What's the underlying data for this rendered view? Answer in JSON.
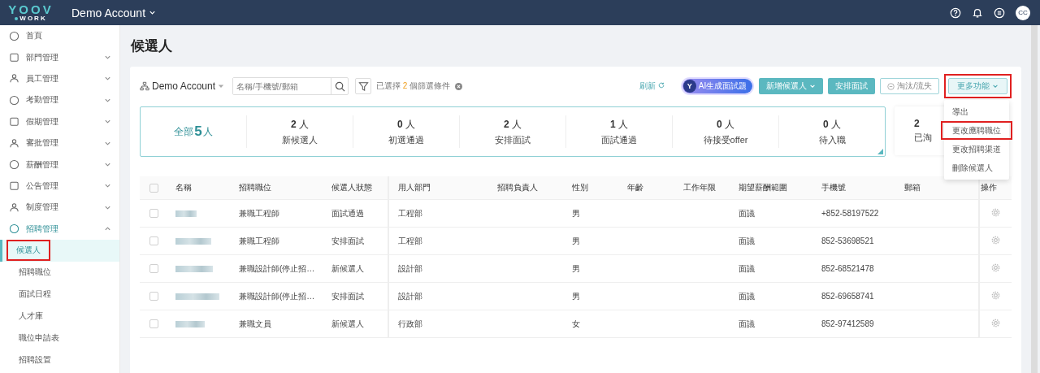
{
  "topbar": {
    "logo_top": "YOOV",
    "logo_bottom": "WORK",
    "account": "Demo Account",
    "avatar": "CC"
  },
  "sidebar": {
    "items": [
      {
        "label": "首頁"
      },
      {
        "label": "部門管理",
        "expanded": false
      },
      {
        "label": "員工管理",
        "expanded": false
      },
      {
        "label": "考勤管理",
        "expanded": false
      },
      {
        "label": "假期管理",
        "expanded": false
      },
      {
        "label": "審批管理",
        "expanded": false
      },
      {
        "label": "薪酬管理",
        "expanded": false
      },
      {
        "label": "公告管理",
        "expanded": false
      },
      {
        "label": "制度管理",
        "expanded": false
      },
      {
        "label": "招聘管理",
        "expanded": true,
        "children": [
          {
            "label": "候選人",
            "selected": true,
            "highlighted": true
          },
          {
            "label": "招聘職位",
            "selected": false,
            "highlighted": false
          },
          {
            "label": "面試日程",
            "selected": false,
            "highlighted": false
          },
          {
            "label": "人才庫",
            "selected": false,
            "highlighted": false
          },
          {
            "label": "職位申請表",
            "selected": false,
            "highlighted": false
          },
          {
            "label": "招聘設置",
            "selected": false,
            "highlighted": false
          }
        ]
      }
    ]
  },
  "page_title": "候選人",
  "toolbar": {
    "account": "Demo Account",
    "search_placeholder": "名稱/手機號/郵箱",
    "filter_prefix": "已選擇",
    "filter_count": "2",
    "filter_suffix": "個篩選條件",
    "refresh": "刷新",
    "ai_button": "AI生成面試題",
    "ai_logo": "Y",
    "add_button": "新增候選人",
    "schedule_button": "安排面試",
    "reject_button": "淘汰/流失",
    "more_button": "更多功能",
    "more_highlighted": true
  },
  "more_menu": [
    {
      "label": "導出",
      "highlighted": false
    },
    {
      "label": "更改應聘職位",
      "highlighted": true
    },
    {
      "label": "更改招聘渠道",
      "highlighted": false
    },
    {
      "label": "刪除候選人",
      "highlighted": false
    }
  ],
  "summary": {
    "total_label": "全部",
    "total_count": "5",
    "total_unit": "人",
    "stats": [
      {
        "count": "2",
        "unit": "人",
        "label": "新候選人"
      },
      {
        "count": "0",
        "unit": "人",
        "label": "初選通過"
      },
      {
        "count": "2",
        "unit": "人",
        "label": "安排面試"
      },
      {
        "count": "1",
        "unit": "人",
        "label": "面試通過"
      },
      {
        "count": "0",
        "unit": "人",
        "label": "待接受offer"
      },
      {
        "count": "0",
        "unit": "人",
        "label": "待入職"
      }
    ],
    "side_card": {
      "count": "2",
      "label": "已淘"
    }
  },
  "table": {
    "all_checked": false,
    "columns": [
      "名稱",
      "招聘職位",
      "候選人狀態",
      "用人部門",
      "招聘負責人",
      "性別",
      "年齡",
      "工作年限",
      "期望薪酬範圍",
      "手機號",
      "郵箱",
      "操作"
    ],
    "rows": [
      {
        "checked": false,
        "name_redacted": true,
        "position": "兼職工程師",
        "status": "面試通過",
        "department": "工程部",
        "gender": "男",
        "salary": "面議",
        "phone": "+852-58197522"
      },
      {
        "checked": false,
        "name_redacted": true,
        "position": "兼職工程師",
        "status": "安排面試",
        "department": "工程部",
        "gender": "男",
        "salary": "面議",
        "phone": "852-53698521"
      },
      {
        "checked": false,
        "name_redacted": true,
        "position": "兼職設計師(停止招…",
        "status": "新候選人",
        "department": "設計部",
        "gender": "男",
        "salary": "面議",
        "phone": "852-68521478"
      },
      {
        "checked": false,
        "name_redacted": true,
        "position": "兼職設計師(停止招…",
        "status": "安排面試",
        "department": "設計部",
        "gender": "男",
        "salary": "面議",
        "phone": "852-69658741"
      },
      {
        "checked": false,
        "name_redacted": true,
        "position": "兼職文員",
        "status": "新候選人",
        "department": "行政部",
        "gender": "女",
        "salary": "面議",
        "phone": "852-97412589"
      }
    ]
  }
}
